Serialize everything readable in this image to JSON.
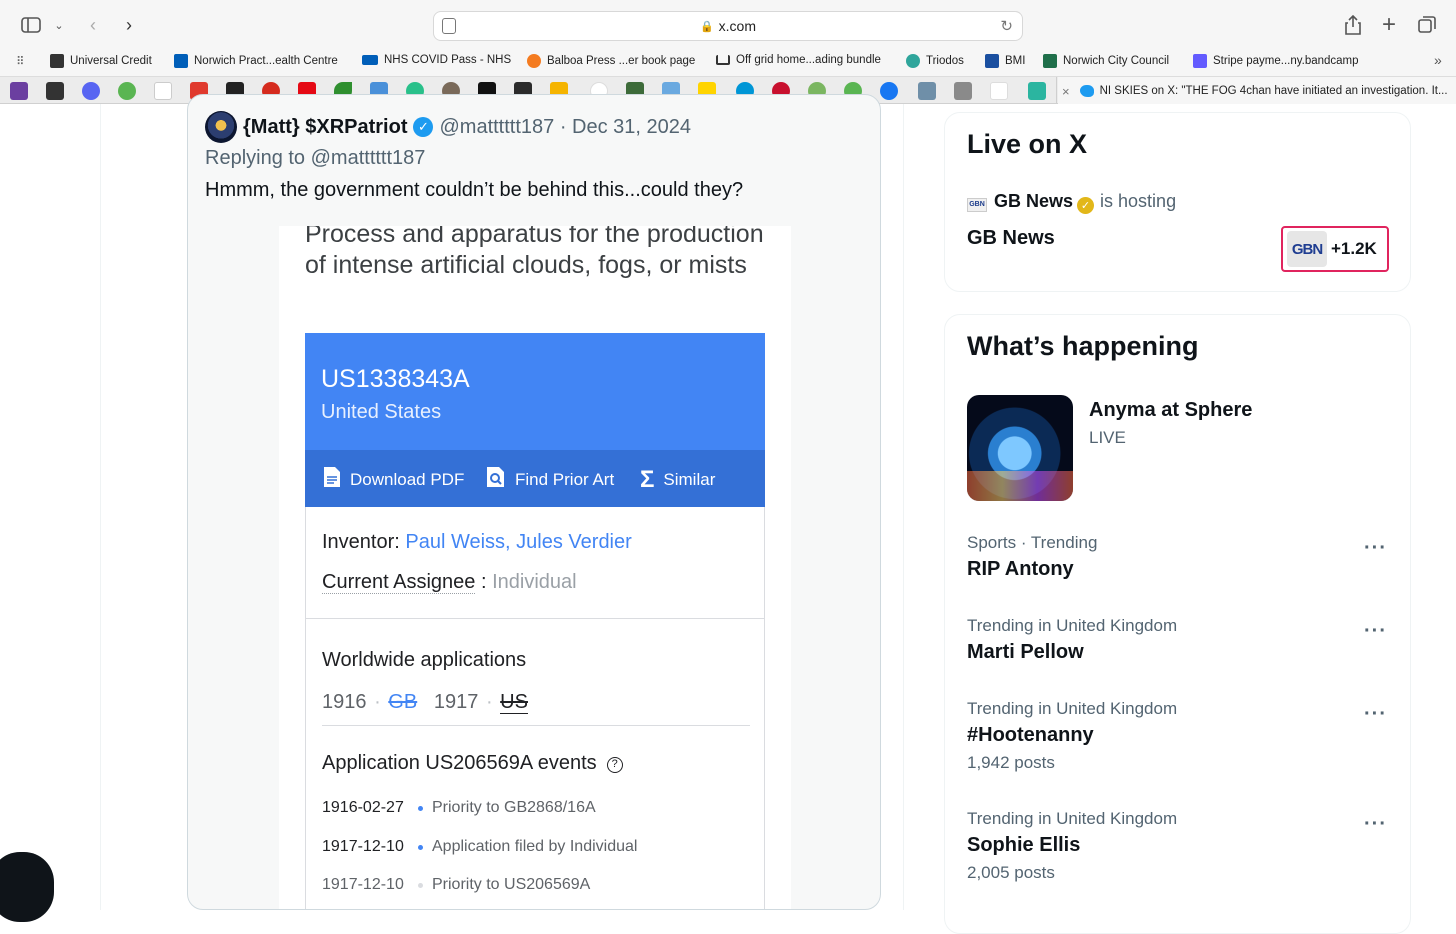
{
  "browser": {
    "url": "x.com",
    "active_tab_title": "NI SKIES on X: \"THE FOG 4chan have initiated an investigation. It..."
  },
  "bookmarks": [
    {
      "label": "Universal Credit",
      "color": "#333333"
    },
    {
      "label": "Norwich Pract...ealth Centre",
      "color": "#005eb8"
    },
    {
      "label": "NHS COVID Pass - NHS",
      "color": "#005eb8"
    },
    {
      "label": "Balboa Press ...er book page",
      "color": "#f47b20"
    },
    {
      "label": "Off grid home...ading bundle",
      "color": "#333333"
    },
    {
      "label": "Triodos",
      "color": "#2fa59b"
    },
    {
      "label": "BMI",
      "color": "#1a4fa0"
    },
    {
      "label": "Norwich City Council",
      "color": "#1f6f4a"
    },
    {
      "label": "Stripe payme...ny.bandcamp",
      "color": "#635bff"
    }
  ],
  "tweet": {
    "name": "{Matt} $XRPatriot",
    "handle_date": "@matttttt187 · Dec 31, 2024",
    "replying_to": "Replying to @matttttt187",
    "text": "Hmmm, the government couldn’t be behind this...could they?",
    "patent": {
      "title": "Process and apparatus for the production of intense artificial clouds, fogs, or mists",
      "number": "US1338343A",
      "country": "United States",
      "actions": [
        "Download PDF",
        "Find Prior Art",
        "Similar"
      ],
      "inventor_label": "Inventor",
      "inventors": "Paul Weiss, Jules Verdier",
      "assignee_label": "Current Assignee",
      "assignee": "Individual",
      "worldwide_title": "Worldwide applications",
      "apps": [
        "1916",
        "GB",
        "1917",
        "US"
      ],
      "events_title": "Application US206569A events",
      "events": [
        {
          "date": "1916-02-27",
          "text": "Priority to GB2868/16A"
        },
        {
          "date": "1917-12-10",
          "text": "Application filed by Individual"
        },
        {
          "date": "1917-12-10",
          "text": "Priority to US206569A"
        }
      ]
    }
  },
  "live": {
    "title": "Live on X",
    "host": "GB News",
    "hosting_text": "is hosting",
    "space_title": "GB News",
    "badge_logo": "GBN",
    "listener_count": "+1.2K"
  },
  "happening": {
    "title": "What’s happening",
    "featured": {
      "title": "Anyma at Sphere",
      "status": "LIVE"
    },
    "trends": [
      {
        "meta": "Sports · Trending",
        "name": "RIP Antony",
        "count": ""
      },
      {
        "meta": "Trending in United Kingdom",
        "name": "Marti Pellow",
        "count": ""
      },
      {
        "meta": "Trending in United Kingdom",
        "name": "#Hootenanny",
        "count": "1,942 posts"
      },
      {
        "meta": "Trending in United Kingdom",
        "name": "Sophie Ellis",
        "count": "2,005 posts"
      }
    ]
  }
}
